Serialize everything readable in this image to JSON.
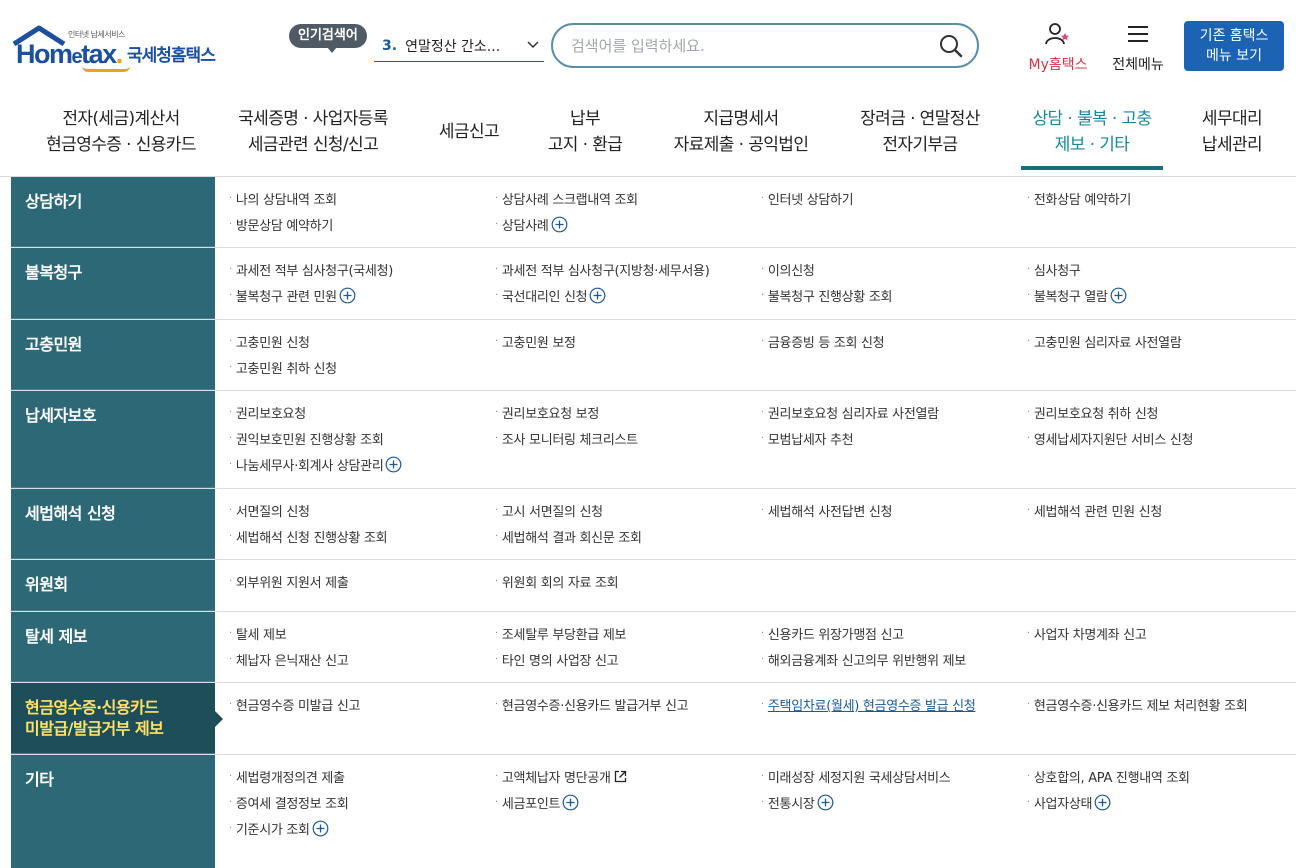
{
  "header": {
    "logo": {
      "tagline": "인터넷 납세서비스",
      "brand_hom": "Hom",
      "brand_e": "e",
      "brand_tax": "tax",
      "brand_dot": ".",
      "name": "국세청홈택스"
    },
    "popular_badge": "인기검색어",
    "popular": {
      "rank": "3.",
      "term": "연말정산 간소..."
    },
    "search": {
      "placeholder": "검색어를 입력하세요.",
      "value": ""
    },
    "my_hometax": "My홈택스",
    "all_menu": "전체메뉴",
    "legacy_button": [
      "기존 홈택스",
      "메뉴 보기"
    ]
  },
  "gnb": [
    {
      "lines": [
        "전자(세금)계산서",
        "현금영수증 · 신용카드"
      ],
      "active": false
    },
    {
      "lines": [
        "국세증명 · 사업자등록",
        "세금관련 신청/신고"
      ],
      "active": false
    },
    {
      "lines": [
        "세금신고"
      ],
      "active": false
    },
    {
      "lines": [
        "납부",
        "고지 · 환급"
      ],
      "active": false
    },
    {
      "lines": [
        "지급명세서",
        "자료제출 · 공익법인"
      ],
      "active": false
    },
    {
      "lines": [
        "장려금 · 연말정산",
        "전자기부금"
      ],
      "active": false
    },
    {
      "lines": [
        "상담 · 불복 · 고충",
        "제보 · 기타"
      ],
      "active": true
    },
    {
      "lines": [
        "세무대리",
        "납세관리"
      ],
      "active": false
    }
  ],
  "menu": [
    {
      "category": [
        "상담하기"
      ],
      "links": [
        {
          "label": "나의 상담내역 조회"
        },
        {
          "label": "상담사례 스크랩내역 조회"
        },
        {
          "label": "인터넷 상담하기"
        },
        {
          "label": "전화상담 예약하기"
        },
        {
          "label": "방문상담 예약하기"
        },
        {
          "label": "상담사례",
          "icon": "plus-circle-icon"
        }
      ]
    },
    {
      "category": [
        "불복청구"
      ],
      "links": [
        {
          "label": "과세전 적부 심사청구(국세청)"
        },
        {
          "label": "과세전 적부 심사청구(지방청·세무서용)"
        },
        {
          "label": "이의신청"
        },
        {
          "label": "심사청구"
        },
        {
          "label": "불복청구 관련 민원",
          "icon": "plus-circle-icon"
        },
        {
          "label": "국선대리인 신청",
          "icon": "plus-circle-icon"
        },
        {
          "label": "불복청구 진행상황 조회"
        },
        {
          "label": "불복청구 열람",
          "icon": "plus-circle-icon"
        }
      ]
    },
    {
      "category": [
        "고충민원"
      ],
      "links": [
        {
          "label": "고충민원 신청"
        },
        {
          "label": "고충민원 보정"
        },
        {
          "label": "금융증빙 등 조회 신청"
        },
        {
          "label": "고충민원 심리자료 사전열람"
        },
        {
          "label": "고충민원 취하 신청"
        }
      ]
    },
    {
      "category": [
        "납세자보호"
      ],
      "links": [
        {
          "label": "권리보호요청"
        },
        {
          "label": "권리보호요청 보정"
        },
        {
          "label": "권리보호요청 심리자료 사전열람"
        },
        {
          "label": "권리보호요청 취하 신청"
        },
        {
          "label": "권익보호민원 진행상황 조회"
        },
        {
          "label": "조사 모니터링 체크리스트"
        },
        {
          "label": "모범납세자 추천"
        },
        {
          "label": "영세납세자지원단 서비스 신청"
        },
        {
          "label": "나눔세무사·회계사 상담관리",
          "icon": "plus-circle-icon"
        }
      ]
    },
    {
      "category": [
        "세법해석 신청"
      ],
      "links": [
        {
          "label": "서면질의 신청"
        },
        {
          "label": "고시 서면질의 신청"
        },
        {
          "label": "세법해석 사전답변 신청"
        },
        {
          "label": "세법해석 관련 민원 신청"
        },
        {
          "label": "세법해석 신청 진행상황 조회"
        },
        {
          "label": "세법해석 결과 회신문 조회"
        }
      ]
    },
    {
      "category": [
        "위원회"
      ],
      "links": [
        {
          "label": "외부위원 지원서 제출"
        },
        {
          "label": "위원회 회의 자료 조회"
        }
      ]
    },
    {
      "category": [
        "탈세 제보"
      ],
      "links": [
        {
          "label": "탈세 제보"
        },
        {
          "label": "조세탈루 부당환급 제보"
        },
        {
          "label": "신용카드 위장가맹점 신고"
        },
        {
          "label": "사업자 차명계좌 신고"
        },
        {
          "label": "체납자 은닉재산 신고"
        },
        {
          "label": "타인 명의 사업장 신고"
        },
        {
          "label": "해외금융계좌 신고의무 위반행위 제보"
        }
      ]
    },
    {
      "category": [
        "현금영수증·신용카드",
        "미발급/발급거부 제보"
      ],
      "active": true,
      "links": [
        {
          "label": "현금영수증 미발급 신고"
        },
        {
          "label": "현금영수증·신용카드 발급거부 신고"
        },
        {
          "label": "주택임차료(월세) 현금영수증 발급 신청",
          "highlight": true
        },
        {
          "label": "현금영수증·신용카드 제보 처리현황 조회"
        }
      ]
    },
    {
      "category": [
        "기타"
      ],
      "links": [
        {
          "label": "세법령개정의견 제출"
        },
        {
          "label": "고액체납자 명단공개",
          "icon": "external-link-icon"
        },
        {
          "label": "미래성장 세정지원 국세상담서비스"
        },
        {
          "label": "상호합의, APA 진행내역 조회"
        },
        {
          "label": "증여세 결정정보 조회"
        },
        {
          "label": "세금포인트",
          "icon": "plus-circle-icon"
        },
        {
          "label": "전통시장",
          "icon": "plus-circle-icon"
        },
        {
          "label": "사업자상태",
          "icon": "plus-circle-icon"
        },
        {
          "label": "기준시가 조회",
          "icon": "plus-circle-icon"
        }
      ]
    }
  ]
}
